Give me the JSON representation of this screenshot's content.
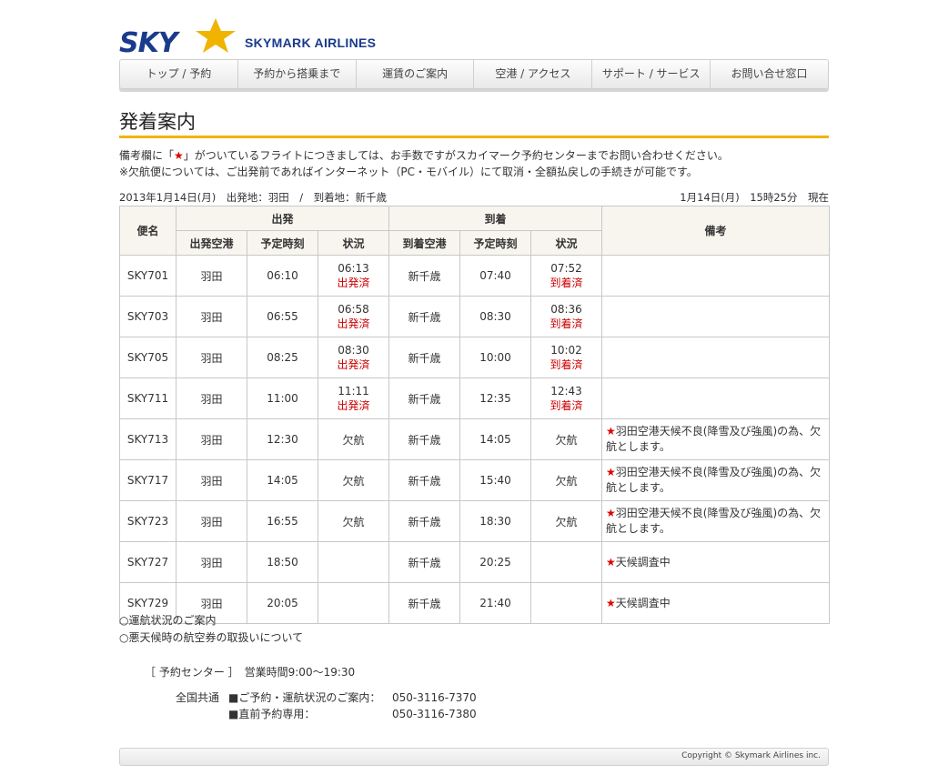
{
  "brand": {
    "logo_text": "SKY",
    "name": "SKYMARK AIRLINES",
    "colors": {
      "navy": "#1a3a8c",
      "star": "#f0b400"
    }
  },
  "nav": [
    "トップ / 予約",
    "予約から搭乗まで",
    "運賃のご案内",
    "空港 / アクセス",
    "サポート / サービス",
    "お問い合せ窓口"
  ],
  "page": {
    "title": "発着案内",
    "notice_1a": "備考欄に「",
    "notice_star": "★",
    "notice_1b": "」がついているフライトにつきましては、お手数ですがスカイマーク予約センターまでお問い合わせください。",
    "notice_2": "※欠航便については、ご出発前であればインターネット（PC・モバイル）にて取消・全額払戻しの手続きが可能です。",
    "meta_left": "2013年1月14日(月)　出発地：羽田　/　到着地：新千歳",
    "meta_right": "1月14日(月)　15時25分　現在"
  },
  "table": {
    "headers": {
      "flight": "便名",
      "departure": "出発",
      "arrival": "到着",
      "remarks": "備考",
      "dep_airport": "出発空港",
      "dep_time": "予定時刻",
      "dep_status": "状況",
      "arr_airport": "到着空港",
      "arr_time": "予定時刻",
      "arr_status": "状況"
    },
    "rows": [
      {
        "flight": "SKY701",
        "dep": "羽田",
        "dep_time": "06:10",
        "dep_st_time": "06:13",
        "dep_st": "出発済",
        "arr": "新千歳",
        "arr_time": "07:40",
        "arr_st_time": "07:52",
        "arr_st": "到着済",
        "remark": ""
      },
      {
        "flight": "SKY703",
        "dep": "羽田",
        "dep_time": "06:55",
        "dep_st_time": "06:58",
        "dep_st": "出発済",
        "arr": "新千歳",
        "arr_time": "08:30",
        "arr_st_time": "08:36",
        "arr_st": "到着済",
        "remark": ""
      },
      {
        "flight": "SKY705",
        "dep": "羽田",
        "dep_time": "08:25",
        "dep_st_time": "08:30",
        "dep_st": "出発済",
        "arr": "新千歳",
        "arr_time": "10:00",
        "arr_st_time": "10:02",
        "arr_st": "到着済",
        "remark": ""
      },
      {
        "flight": "SKY711",
        "dep": "羽田",
        "dep_time": "11:00",
        "dep_st_time": "11:11",
        "dep_st": "出発済",
        "arr": "新千歳",
        "arr_time": "12:35",
        "arr_st_time": "12:43",
        "arr_st": "到着済",
        "remark": ""
      },
      {
        "flight": "SKY713",
        "dep": "羽田",
        "dep_time": "12:30",
        "dep_st_time": "",
        "dep_st": "欠航",
        "arr": "新千歳",
        "arr_time": "14:05",
        "arr_st_time": "",
        "arr_st": "欠航",
        "remark": "羽田空港天候不良(降雪及び強風)の為、欠航とします。"
      },
      {
        "flight": "SKY717",
        "dep": "羽田",
        "dep_time": "14:05",
        "dep_st_time": "",
        "dep_st": "欠航",
        "arr": "新千歳",
        "arr_time": "15:40",
        "arr_st_time": "",
        "arr_st": "欠航",
        "remark": "羽田空港天候不良(降雪及び強風)の為、欠航とします。"
      },
      {
        "flight": "SKY723",
        "dep": "羽田",
        "dep_time": "16:55",
        "dep_st_time": "",
        "dep_st": "欠航",
        "arr": "新千歳",
        "arr_time": "18:30",
        "arr_st_time": "",
        "arr_st": "欠航",
        "remark": "羽田空港天候不良(降雪及び強風)の為、欠航とします。"
      },
      {
        "flight": "SKY727",
        "dep": "羽田",
        "dep_time": "18:50",
        "dep_st_time": "",
        "dep_st": "",
        "arr": "新千歳",
        "arr_time": "20:25",
        "arr_st_time": "",
        "arr_st": "",
        "remark": "天候調査中"
      },
      {
        "flight": "SKY729",
        "dep": "羽田",
        "dep_time": "20:05",
        "dep_st_time": "",
        "dep_st": "",
        "arr": "新千歳",
        "arr_time": "21:40",
        "arr_st_time": "",
        "arr_st": "",
        "remark": "天候調査中"
      }
    ]
  },
  "links": [
    "○運航状況のご案内",
    "○悪天候時の航空券の取扱いについて"
  ],
  "contact": {
    "center": "［ 予約センター ］　営業時間9:00～19:30",
    "label": "全国共通",
    "lines": [
      {
        "desc": "■ご予約・運航状況のご案内：",
        "phone": "050-3116-7370"
      },
      {
        "desc": "■直前予約専用：",
        "phone": "050-3116-7380"
      }
    ]
  },
  "footer": {
    "copyright": "Copyright © Skymark Airlines inc."
  }
}
